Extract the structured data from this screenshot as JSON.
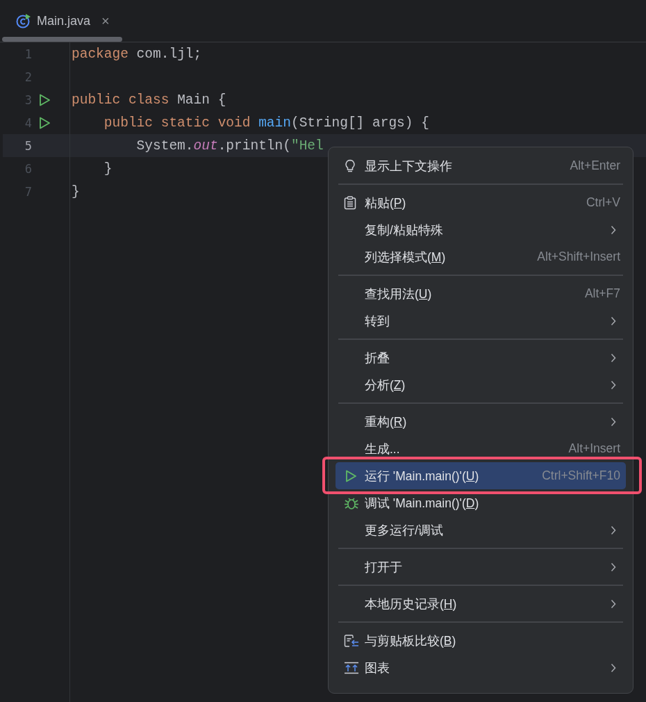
{
  "tabs": [
    {
      "label": "Main.java",
      "selected": true,
      "close": "×"
    }
  ],
  "editor": {
    "lines": [
      {
        "number": "1",
        "run": false,
        "current": false,
        "tokens": [
          {
            "kind": "keyword",
            "text": "package"
          },
          {
            "kind": "plain",
            "text": " com.ljl;"
          }
        ]
      },
      {
        "number": "2",
        "run": false,
        "current": false
      },
      {
        "number": "3",
        "run": true,
        "current": false,
        "tokens": [
          {
            "kind": "keyword",
            "text": "public class"
          },
          {
            "kind": "plain",
            "text": " Main {"
          }
        ]
      },
      {
        "number": "4",
        "run": true,
        "current": false,
        "tokens": [
          {
            "kind": "keyword",
            "text": "    public static void"
          },
          {
            "kind": "method",
            "text": " main"
          },
          {
            "kind": "plain",
            "text": "(String[] args) {"
          }
        ]
      },
      {
        "number": "5",
        "run": false,
        "current": true,
        "tokens": [
          {
            "kind": "plain",
            "text": "        System."
          },
          {
            "kind": "field",
            "text": "out"
          },
          {
            "kind": "plain",
            "text": ".println("
          },
          {
            "kind": "string",
            "text": "\"Hel"
          }
        ]
      },
      {
        "number": "6",
        "run": false,
        "current": false,
        "tokens": [
          {
            "kind": "plain",
            "text": "    }"
          }
        ]
      },
      {
        "number": "7",
        "run": false,
        "current": false,
        "tokens": [
          {
            "kind": "plain",
            "text": "}"
          }
        ]
      }
    ]
  },
  "context_menu": {
    "groups": [
      [
        {
          "kind": "bulb",
          "label": "显示上下文操作",
          "shortcut": "Alt+Enter",
          "submenu": false,
          "selected": false,
          "annotated": false
        }
      ],
      [
        {
          "kind": "clipboard",
          "label": "粘贴(",
          "mnemonic": "P",
          "label_end": ")",
          "shortcut": "Ctrl+V",
          "submenu": false,
          "selected": false,
          "annotated": false
        },
        {
          "label": "复制/粘贴特殊",
          "submenu": true,
          "selected": false,
          "annotated": false
        },
        {
          "label": "列选择模式(",
          "mnemonic": "M",
          "label_end": ")",
          "shortcut": "Alt+Shift+Insert",
          "submenu": false,
          "selected": false,
          "annotated": false
        }
      ],
      [
        {
          "label": "查找用法(",
          "mnemonic": "U",
          "label_end": ")",
          "shortcut": "Alt+F7",
          "submenu": false,
          "selected": false,
          "annotated": false
        },
        {
          "label": "转到",
          "submenu": true,
          "selected": false,
          "annotated": false
        }
      ],
      [
        {
          "label": "折叠",
          "submenu": true,
          "selected": false,
          "annotated": false
        },
        {
          "label": "分析(",
          "mnemonic": "Z",
          "label_end": ")",
          "submenu": true,
          "selected": false,
          "annotated": false
        }
      ],
      [
        {
          "label": "重构(",
          "mnemonic": "R",
          "label_end": ")",
          "submenu": true,
          "selected": false,
          "annotated": false
        },
        {
          "label": "生成...",
          "shortcut": "Alt+Insert",
          "submenu": false,
          "selected": false,
          "annotated": false
        },
        {
          "kind": "run",
          "label": "运行 'Main.main()'(",
          "mnemonic": "U",
          "label_end": ")",
          "shortcut": "Ctrl+Shift+F10",
          "submenu": false,
          "selected": true,
          "annotated": true
        },
        {
          "kind": "bug",
          "label": "调试 'Main.main()'(",
          "mnemonic": "D",
          "label_end": ")",
          "submenu": false,
          "selected": false,
          "annotated": false
        },
        {
          "label": "更多运行/调试",
          "submenu": true,
          "selected": false,
          "annotated": false
        }
      ],
      [
        {
          "label": "打开于",
          "submenu": true,
          "selected": false,
          "annotated": false
        }
      ],
      [
        {
          "label": "本地历史记录(",
          "mnemonic": "H",
          "label_end": ")",
          "submenu": true,
          "selected": false,
          "annotated": false
        }
      ],
      [
        {
          "kind": "compare",
          "label": "与剪贴板比较(",
          "mnemonic": "B",
          "label_end": ")",
          "submenu": false,
          "selected": false,
          "annotated": false
        },
        {
          "kind": "diagram",
          "label": "图表",
          "submenu": true,
          "selected": false,
          "annotated": false
        }
      ]
    ]
  }
}
